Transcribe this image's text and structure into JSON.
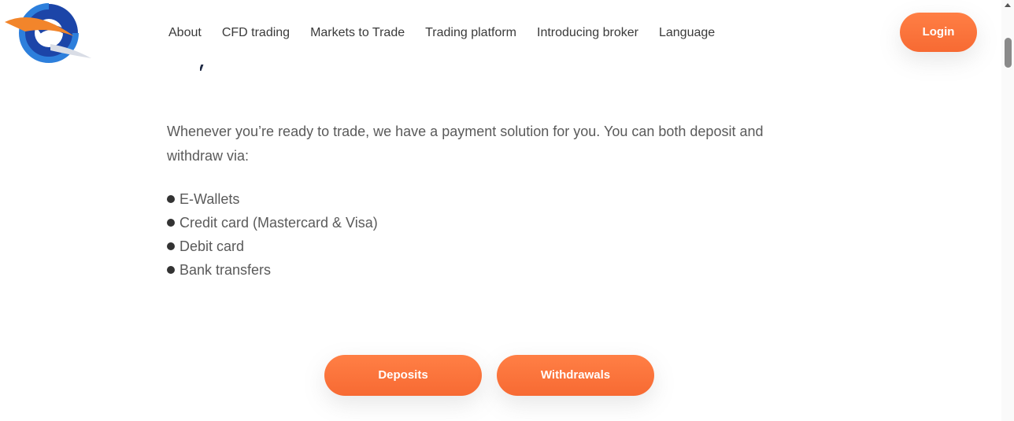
{
  "header": {
    "logo_icon": "globe-swoosh-logo",
    "nav": [
      {
        "label": "About"
      },
      {
        "label": "CFD trading"
      },
      {
        "label": "Markets to Trade"
      },
      {
        "label": "Trading platform"
      },
      {
        "label": "Introducing broker"
      },
      {
        "label": "Language"
      }
    ],
    "login_label": "Login"
  },
  "main": {
    "intro": "Whenever you’re ready to trade, we have a payment solution for you. You can both deposit and withdraw via:",
    "methods": [
      "E-Wallets",
      "Credit card (Mastercard & Visa)",
      "Debit card",
      "Bank transfers"
    ],
    "deposits_label": "Deposits",
    "withdrawals_label": "Withdrawals"
  },
  "colors": {
    "accent": "#f76a33",
    "logo_blue": "#1f4fb5",
    "logo_orange": "#f2852b"
  }
}
